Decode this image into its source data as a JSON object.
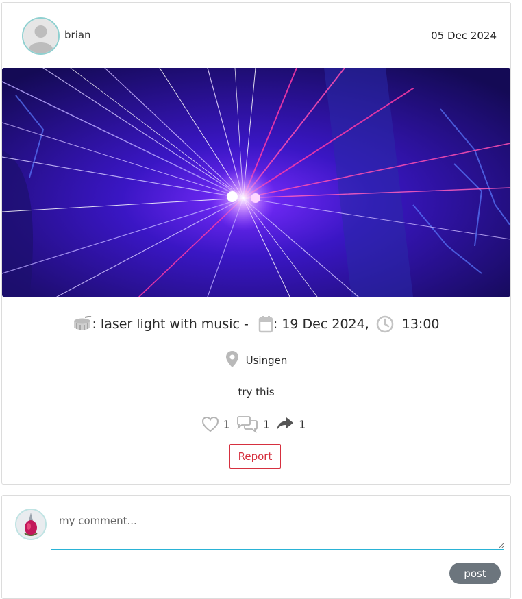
{
  "post": {
    "author": "brian",
    "date": "05 Dec 2024",
    "image_icon": "laser-light-photo",
    "event": {
      "title_sep": ": ",
      "title": "laser light with music",
      "dash": " -",
      "date_sep": ": ",
      "date": "19 Dec 2024,",
      "time": "13:00"
    },
    "location": "Usingen",
    "description": "try this",
    "stats": {
      "likes": "1",
      "comments": "1",
      "shares": "1"
    },
    "report_label": "Report"
  },
  "comment": {
    "placeholder": "my comment...",
    "post_label": "post"
  },
  "icons": {
    "drum": "drum-icon",
    "calendar": "calendar-icon",
    "clock": "clock-icon",
    "location": "map-pin-icon",
    "like": "heart-icon",
    "comment": "comments-icon",
    "share": "share-icon"
  },
  "colors": {
    "report": "#d6303f",
    "input_underline": "#2ab3d6",
    "post_button": "#6c757d",
    "avatar_ring": "#8fd0d0"
  }
}
